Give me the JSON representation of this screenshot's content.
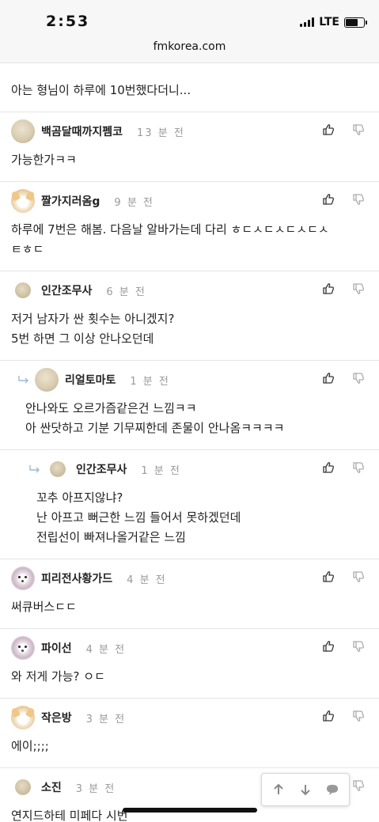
{
  "status": {
    "time": "2:53",
    "network": "LTE"
  },
  "browser": {
    "url": "fmkorea.com"
  },
  "comments": [
    {
      "nick": "",
      "time": "",
      "body": "아는 형님이 하루에 10번했다더니...",
      "avatar": "blob",
      "partial_top": true
    },
    {
      "nick": "백곰달때까지펨코",
      "time": "13 분 전",
      "body": "가능한가ㅋㅋ",
      "avatar": "blob"
    },
    {
      "nick": "짤가지러옴g",
      "time": "9 분 전",
      "body": "하루에 7번은 해봄. 다음날 알바가는데 다리 ㅎㄷㅅㄷㅅㄷㅅㄷㅅ\nㅌㅎㄷ",
      "avatar": "dog"
    },
    {
      "nick": "인간조무사",
      "time": "6 분 전",
      "body": "저거 남자가 싼 횟수는 아니겠지?\n5번 하면 그 이상 안나오던데",
      "avatar": "small"
    },
    {
      "nick": "리얼토마토",
      "time": "1 분 전",
      "body": "안나와도 오르가즘같은건 느낌ㅋㅋ\n아 싼닷하고 기분 기무찌한데 존물이 안나옴ㅋㅋㅋㅋ",
      "avatar": "blob",
      "reply": 1
    },
    {
      "nick": "인간조무사",
      "time": "1 분 전",
      "body": "꼬추 아프지않냐?\n난 아프고 뻐근한 느낌 들어서 못하겠던데\n전립선이 빠져나올거같은 느낌",
      "avatar": "small",
      "reply": 2
    },
    {
      "nick": "피리전사황가드",
      "time": "4 분 전",
      "body": "써큐버스ㄷㄷ",
      "avatar": "poodle"
    },
    {
      "nick": "파이선",
      "time": "4 분 전",
      "body": "와 저게 가능? ㅇㄷ",
      "avatar": "poodle"
    },
    {
      "nick": "작은방",
      "time": "3 분 전",
      "body": "에이;;;;",
      "avatar": "dog"
    },
    {
      "nick": "소진",
      "time": "3 분 전",
      "body": "연지드하테 미페다 시번",
      "avatar": "small"
    }
  ]
}
